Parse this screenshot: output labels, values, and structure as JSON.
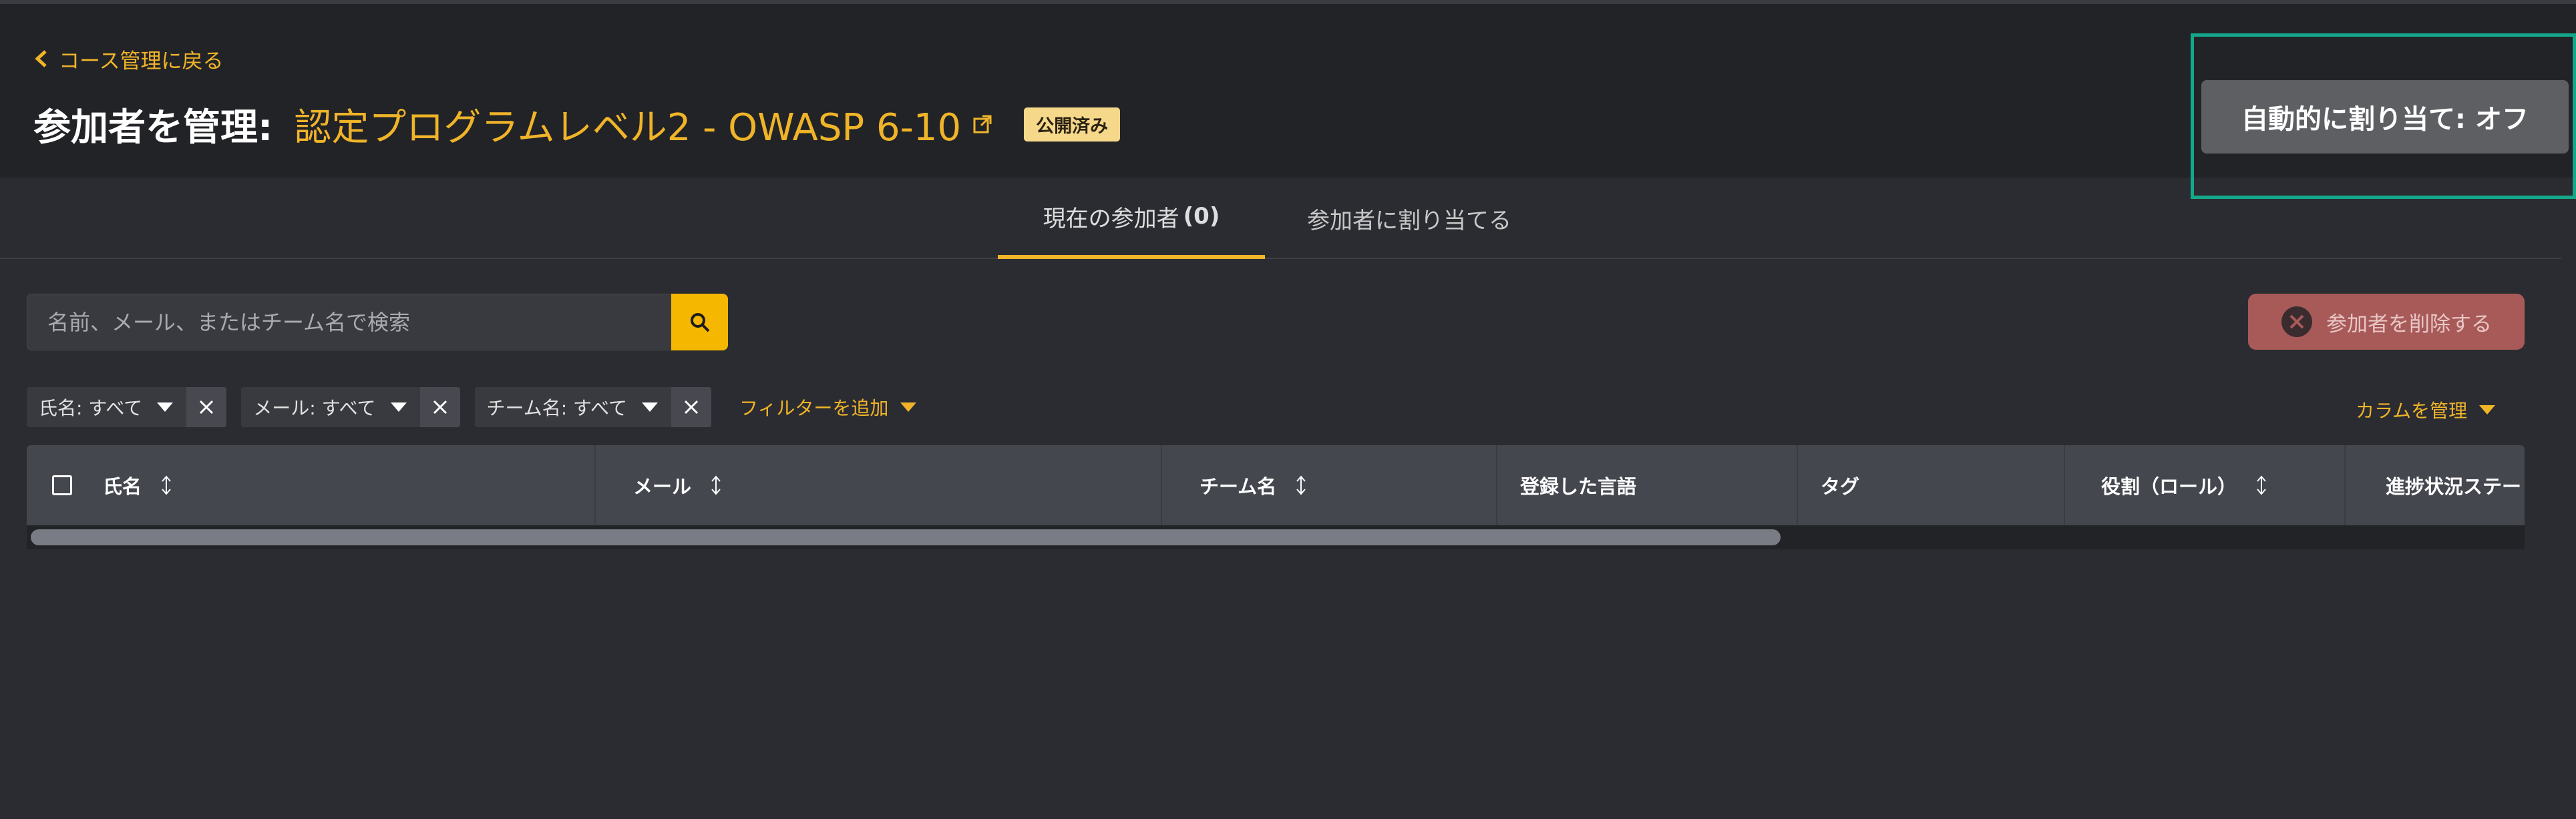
{
  "header": {
    "back_label": "コース管理に戻る",
    "title_prefix": "参加者を管理:",
    "course_name": "認定プログラムレベル2 - OWASP 6-10",
    "status_badge": "公開済み",
    "auto_assign_label": "自動的に割り当て: オフ"
  },
  "tabs": {
    "current_label": "現在の参加者",
    "current_count": "(0)",
    "assign_label": "参加者に割り当てる"
  },
  "search": {
    "placeholder": "名前、メール、またはチーム名で検索"
  },
  "actions": {
    "remove_label": "参加者を削除する",
    "manage_columns_label": "カラムを管理"
  },
  "filters": {
    "chips": [
      {
        "label": "氏名: すべて"
      },
      {
        "label": "メール: すべて"
      },
      {
        "label": "チーム名: すべて"
      }
    ],
    "add_label": "フィルターを追加"
  },
  "table": {
    "columns": [
      "氏名",
      "メール",
      "チーム名",
      "登録した言語",
      "タグ",
      "役割（ロール）",
      "進捗状況ステー"
    ]
  },
  "colors": {
    "accent": "#f0b429",
    "highlight_frame": "#14a88a",
    "remove_button": "#a85a59"
  }
}
